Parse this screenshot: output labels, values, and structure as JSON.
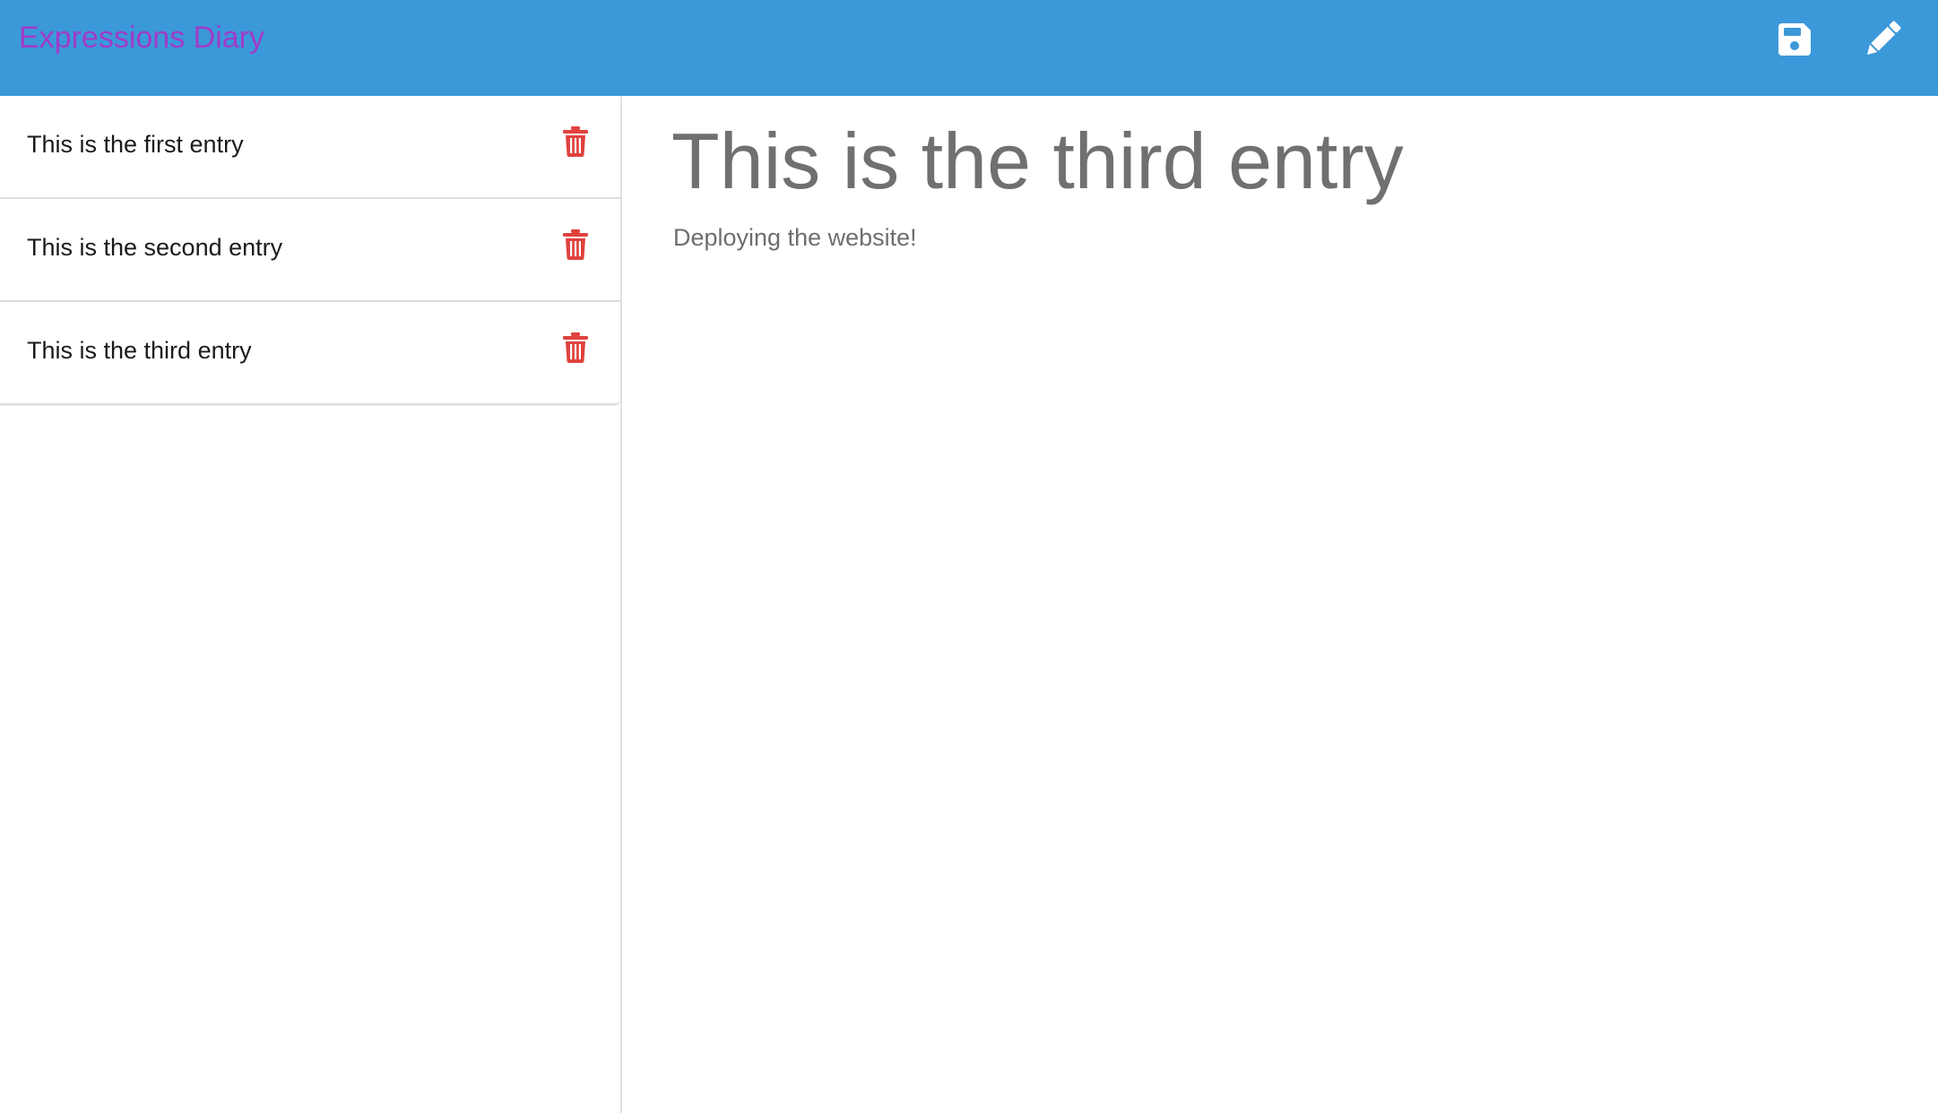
{
  "app": {
    "brand": "Expressions Diary",
    "colors": {
      "navbar": "#3b98d9",
      "brand_text": "#a03bc8",
      "delete_icon": "#e0423e",
      "nav_icon": "#ffffff"
    }
  },
  "toolbar": {
    "save_icon": "floppy-disk",
    "edit_icon": "pencil"
  },
  "sidebar": {
    "items": [
      {
        "title": "This is the first entry",
        "icon": "trash"
      },
      {
        "title": "This is the second entry",
        "icon": "trash"
      },
      {
        "title": "This is the third entry",
        "icon": "trash"
      }
    ]
  },
  "main": {
    "title": "This is the third entry",
    "body": "Deploying the website!"
  }
}
